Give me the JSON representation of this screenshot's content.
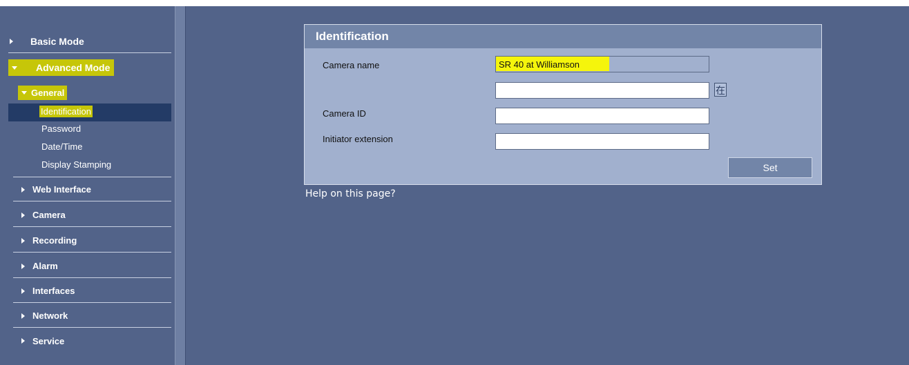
{
  "sidebar": {
    "basic_mode": "Basic Mode",
    "advanced_mode": "Advanced Mode",
    "general": "General",
    "general_items": [
      "Identification",
      "Password",
      "Date/Time",
      "Display Stamping"
    ],
    "sections": [
      "Web Interface",
      "Camera",
      "Recording",
      "Alarm",
      "Interfaces",
      "Network",
      "Service"
    ]
  },
  "panel": {
    "title": "Identification",
    "camera_name_label": "Camera name",
    "camera_name_value": "SR 40 at Williamson",
    "camera_name_second_value": "",
    "camera_id_label": "Camera ID",
    "camera_id_value": "",
    "initiator_label": "Initiator extension",
    "initiator_value": "",
    "kanji_glyph": "在",
    "set_label": "Set"
  },
  "help_link": "Help on this page?",
  "colors": {
    "background": "#526389",
    "panel": "#a1b0ce",
    "panel_header": "#7285a8",
    "highlight": "#f2f20a"
  }
}
